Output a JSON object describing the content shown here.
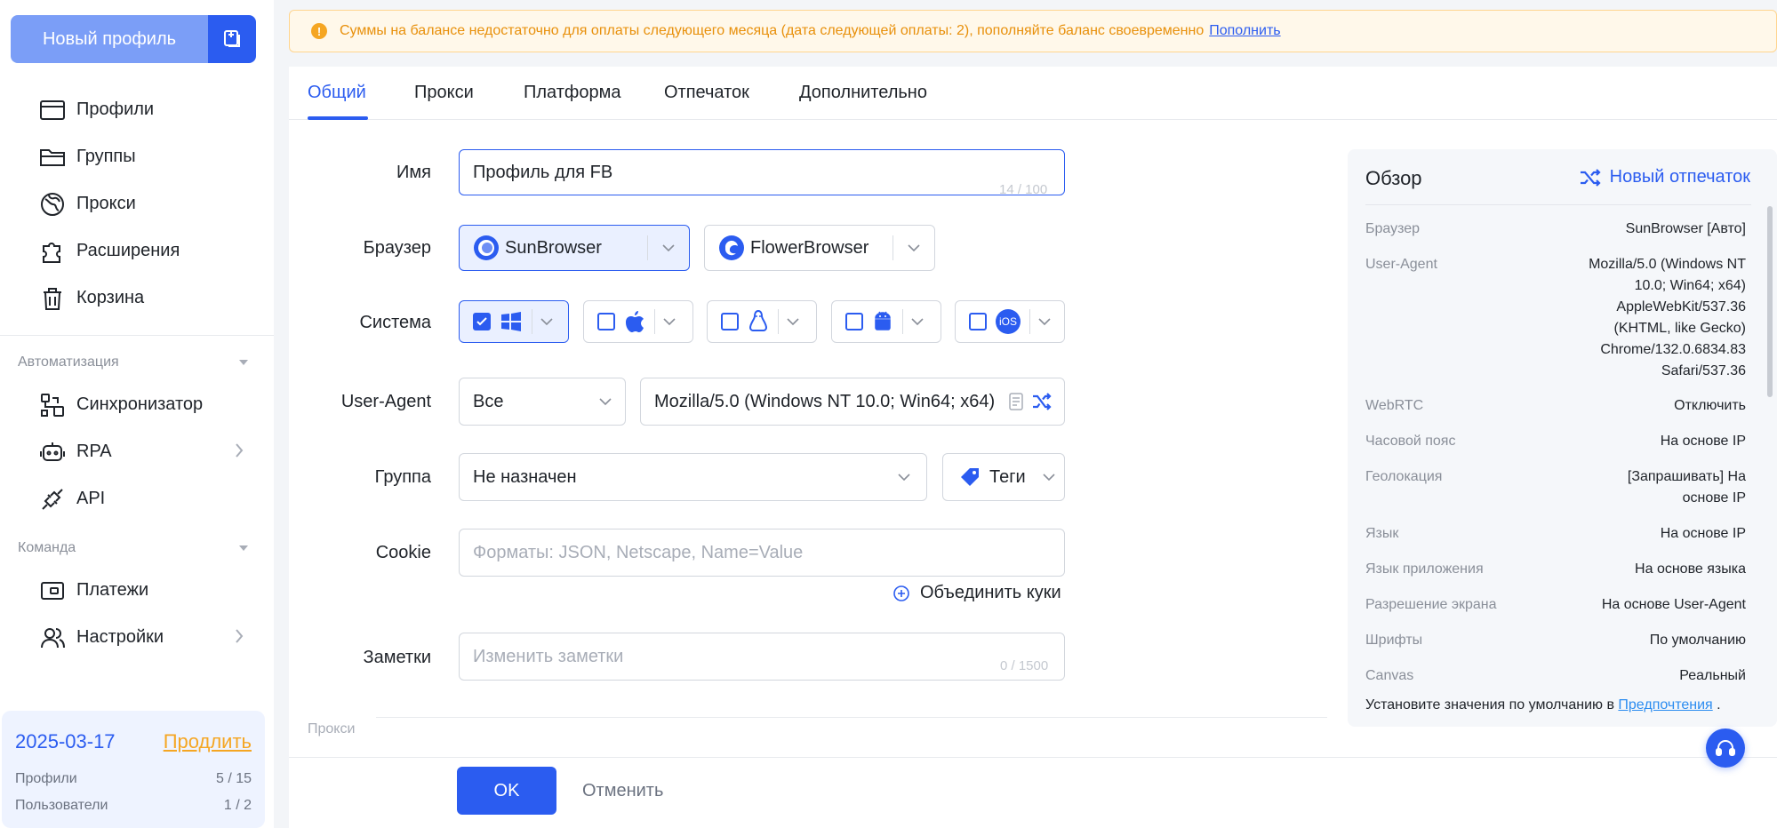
{
  "sidebar": {
    "new_profile_label": "Новый профиль",
    "nav": [
      {
        "label": "Профили",
        "icon": "window-icon"
      },
      {
        "label": "Группы",
        "icon": "folder-icon"
      },
      {
        "label": "Прокси",
        "icon": "globe-icon"
      },
      {
        "label": "Расширения",
        "icon": "puzzle-icon"
      },
      {
        "label": "Корзина",
        "icon": "trash-icon"
      }
    ],
    "automation_title": "Автоматизация",
    "automation": [
      {
        "label": "Синхронизатор",
        "icon": "sync-icon"
      },
      {
        "label": "RPA",
        "icon": "robot-icon"
      },
      {
        "label": "API",
        "icon": "plug-icon"
      }
    ],
    "team_title": "Команда",
    "team": [
      {
        "label": "Платежи",
        "icon": "wallet-icon"
      },
      {
        "label": "Настройки",
        "icon": "users-icon"
      }
    ],
    "subscription": {
      "date": "2025-03-17",
      "renew": "Продлить",
      "profiles_label": "Профили",
      "profiles_value": "5 / 15",
      "users_label": "Пользователи",
      "users_value": "1 / 2"
    }
  },
  "banner": {
    "text": "Суммы на балансе недостаточно для оплаты следующего месяца (дата следующей оплаты: 2), пополняйте баланс своевременно",
    "link": "Пополнить"
  },
  "tabs": [
    "Общий",
    "Прокси",
    "Платформа",
    "Отпечаток",
    "Дополнительно"
  ],
  "form": {
    "name_label": "Имя",
    "name_value": "Профиль для FB",
    "name_counter": "14 / 100",
    "browser_label": "Браузер",
    "browsers": [
      "SunBrowser",
      "FlowerBrowser"
    ],
    "system_label": "Система",
    "ios_label": "iOS",
    "ua_label": "User-Agent",
    "ua_filter": "Все",
    "ua_value": "Mozilla/5.0 (Windows NT 10.0; Win64; x64)",
    "group_label": "Группа",
    "group_value": "Не назначен",
    "tags_label": "Теги",
    "cookie_label": "Cookie",
    "cookie_placeholder": "Форматы: JSON, Netscape, Name=Value",
    "merge_cookies": "Объединить куки",
    "notes_label": "Заметки",
    "notes_placeholder": "Изменить заметки",
    "notes_counter": "0 / 1500",
    "proxy_section": "Прокси",
    "ok": "OK",
    "cancel": "Отменить"
  },
  "overview": {
    "title": "Обзор",
    "new_fingerprint": "Новый отпечаток",
    "rows": [
      {
        "k": "Браузер",
        "v": "SunBrowser [Авто]"
      },
      {
        "k": "User-Agent",
        "v": "Mozilla/5.0 (Windows NT 10.0; Win64; x64) AppleWebKit/537.36 (KHTML, like Gecko) Chrome/132.0.6834.83 Safari/537.36"
      },
      {
        "k": "WebRTC",
        "v": "Отключить"
      },
      {
        "k": "Часовой пояс",
        "v": "На основе IP"
      },
      {
        "k": "Геолокация",
        "v": "[Запрашивать] На основе IP"
      },
      {
        "k": "Язык",
        "v": "На основе IP"
      },
      {
        "k": "Язык приложения",
        "v": "На основе языка"
      },
      {
        "k": "Разрешение экрана",
        "v": "На основе User-Agent"
      },
      {
        "k": "Шрифты",
        "v": "По умолчанию"
      },
      {
        "k": "Canvas",
        "v": "Реальный"
      }
    ],
    "footer_text": "Установите значения по умолчанию в",
    "footer_link": "Предпочтения",
    "footer_end": "."
  },
  "colors": {
    "accent": "#2b5cf0",
    "warning": "#f5a623"
  }
}
